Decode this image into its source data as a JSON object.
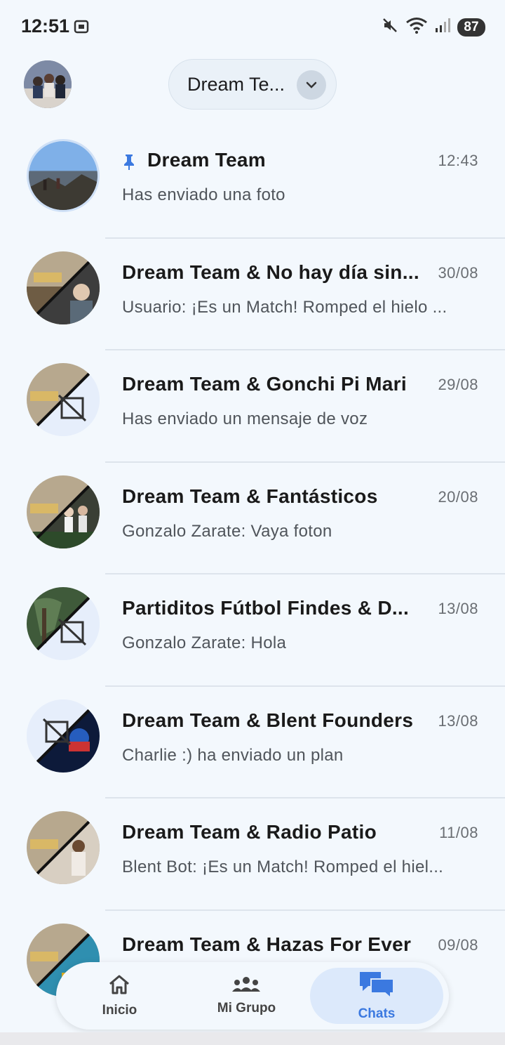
{
  "status_bar": {
    "time": "12:51",
    "battery": "87",
    "icons": [
      "screenshot-icon",
      "mute-icon",
      "wifi-icon",
      "signal-icon",
      "battery-icon"
    ]
  },
  "header": {
    "group_selector_label": "Dream Te...",
    "avatar": "profile-avatar"
  },
  "chats": [
    {
      "title": "Dream Team",
      "time": "12:43",
      "preview": "Has enviado una foto",
      "pinned": true
    },
    {
      "title": "Dream Team & No hay día sin...",
      "time": "30/08",
      "preview": "Usuario: ¡Es un Match! Romped el hielo ..."
    },
    {
      "title": "Dream Team & Gonchi Pi Mari",
      "time": "29/08",
      "preview": "Has enviado un mensaje de voz"
    },
    {
      "title": "Dream Team & Fantásticos",
      "time": "20/08",
      "preview": "Gonzalo Zarate: Vaya foton"
    },
    {
      "title": "Partiditos  Fútbol Findes & D...",
      "time": "13/08",
      "preview": "Gonzalo Zarate: Hola"
    },
    {
      "title": "Dream Team & Blent Founders",
      "time": "13/08",
      "preview": "Charlie :) ha enviado un plan"
    },
    {
      "title": "Dream Team & Radio Patio",
      "time": "11/08",
      "preview": "Blent Bot: ¡Es un Match! Romped el hiel..."
    },
    {
      "title": "Dream Team & Hazas For Ever",
      "time": "09/08",
      "preview": ""
    }
  ],
  "bottom_nav": {
    "items": [
      {
        "label": "Inicio",
        "icon": "home-icon",
        "active": false
      },
      {
        "label": "Mi Grupo",
        "icon": "group-icon",
        "active": false
      },
      {
        "label": "Chats",
        "icon": "chats-icon",
        "active": true
      }
    ]
  },
  "colors": {
    "background": "#f3f8fd",
    "accent": "#3b79e0",
    "active_nav_bg": "#dce9fb",
    "pin": "#3b79e0"
  }
}
